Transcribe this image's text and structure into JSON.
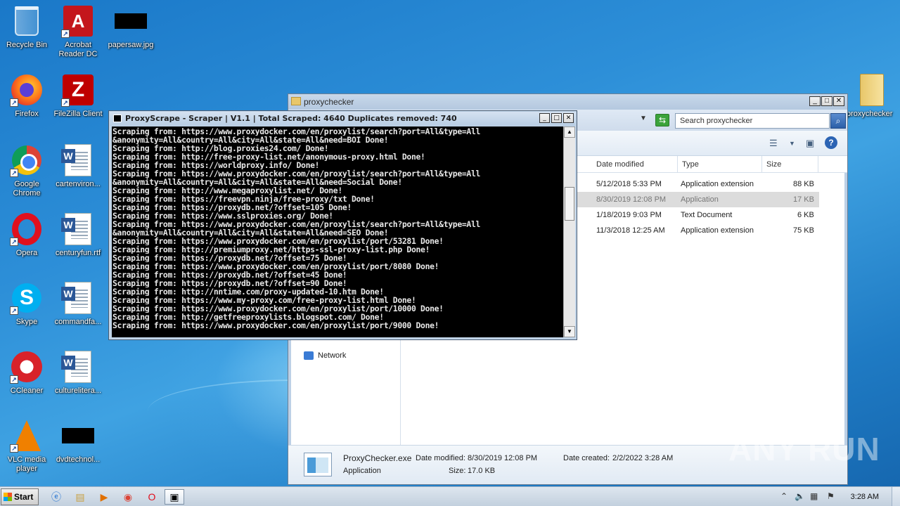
{
  "desktop": {
    "icons": [
      {
        "label": "Recycle Bin",
        "icon": "recycle-bin-icon"
      },
      {
        "label": "Acrobat Reader DC",
        "icon": "acrobat-icon"
      },
      {
        "label": "papersaw.jpg",
        "icon": "image-file-icon"
      },
      {
        "label": "Firefox",
        "icon": "firefox-icon"
      },
      {
        "label": "FileZilla Client",
        "icon": "filezilla-icon"
      },
      {
        "label": "Google Chrome",
        "icon": "chrome-icon"
      },
      {
        "label": "cartenviron...",
        "icon": "word-doc-icon"
      },
      {
        "label": "Opera",
        "icon": "opera-icon"
      },
      {
        "label": "centuryfun.rtf",
        "icon": "word-doc-icon"
      },
      {
        "label": "Skype",
        "icon": "skype-icon"
      },
      {
        "label": "commandfa...",
        "icon": "word-doc-icon"
      },
      {
        "label": "CCleaner",
        "icon": "ccleaner-icon"
      },
      {
        "label": "culturelitera...",
        "icon": "word-doc-icon"
      },
      {
        "label": "VLC media player",
        "icon": "vlc-icon"
      },
      {
        "label": "dvdtechnol...",
        "icon": "image-file-icon"
      },
      {
        "label": "proxychecker",
        "icon": "folder-icon"
      }
    ]
  },
  "explorer": {
    "title": "proxychecker",
    "search_placeholder": "Search proxychecker",
    "columns": [
      "Date modified",
      "Type",
      "Size"
    ],
    "rows": [
      {
        "date": "5/12/2018 5:33 PM",
        "type": "Application extension",
        "size": "88 KB",
        "selected": false
      },
      {
        "date": "8/30/2019 12:08 PM",
        "type": "Application",
        "size": "17 KB",
        "selected": true
      },
      {
        "date": "1/18/2019 9:03 PM",
        "type": "Text Document",
        "size": "6 KB",
        "selected": false
      },
      {
        "date": "11/3/2018 12:25 AM",
        "type": "Application extension",
        "size": "75 KB",
        "selected": false
      }
    ],
    "nav_network": "Network",
    "details": {
      "filename": "ProxyChecker.exe",
      "kind": "Application",
      "date_modified_label": "Date modified:",
      "date_modified": "8/30/2019 12:08 PM",
      "date_created_label": "Date created:",
      "date_created": "2/2/2022 3:28 AM",
      "size_label": "Size:",
      "size": "17.0 KB"
    }
  },
  "console": {
    "title": "ProxyScrape - Scraper | V1.1 | Total Scraped: 4640 Duplicates removed: 740",
    "lines": [
      "Scraping from: https://www.proxydocker.com/en/proxylist/search?port=All&type=All",
      "&anonymity=All&country=All&city=All&state=All&need=BOI Done!",
      "Scraping from: http://blog.proxies24.com/ Done!",
      "Scraping from: http://free-proxy-list.net/anonymous-proxy.html Done!",
      "Scraping from: https://worldproxy.info/ Done!",
      "Scraping from: https://www.proxydocker.com/en/proxylist/search?port=All&type=All",
      "&anonymity=All&country=All&city=All&state=All&need=Social Done!",
      "Scraping from: http://www.megaproxylist.net/ Done!",
      "Scraping from: https://freevpn.ninja/free-proxy/txt Done!",
      "Scraping from: https://proxydb.net/?offset=105 Done!",
      "Scraping from: https://www.sslproxies.org/ Done!",
      "Scraping from: https://www.proxydocker.com/en/proxylist/search?port=All&type=All",
      "&anonymity=All&country=All&city=All&state=All&need=SEO Done!",
      "Scraping from: https://www.proxydocker.com/en/proxylist/port/53281 Done!",
      "Scraping from: http://premiumproxy.net/https-ssl-proxy-list.php Done!",
      "Scraping from: https://proxydb.net/?offset=75 Done!",
      "Scraping from: https://www.proxydocker.com/en/proxylist/port/8080 Done!",
      "Scraping from: https://proxydb.net/?offset=45 Done!",
      "Scraping from: https://proxydb.net/?offset=90 Done!",
      "Scraping from: http://nntime.com/proxy-updated-10.htm Done!",
      "Scraping from: https://www.my-proxy.com/free-proxy-list.html Done!",
      "Scraping from: https://www.proxydocker.com/en/proxylist/port/10000 Done!",
      "Scraping from: http://getfreeproxylists.blogspot.com/ Done!",
      "Scraping from: https://www.proxydocker.com/en/proxylist/port/9000 Done!"
    ]
  },
  "taskbar": {
    "start_label": "Start",
    "clock": "3:28 AM",
    "items": [
      "ie-icon",
      "explorer-icon",
      "media-player-icon",
      "chrome-icon",
      "opera-icon",
      "console-app-icon"
    ]
  },
  "watermark": "ANY RUN"
}
